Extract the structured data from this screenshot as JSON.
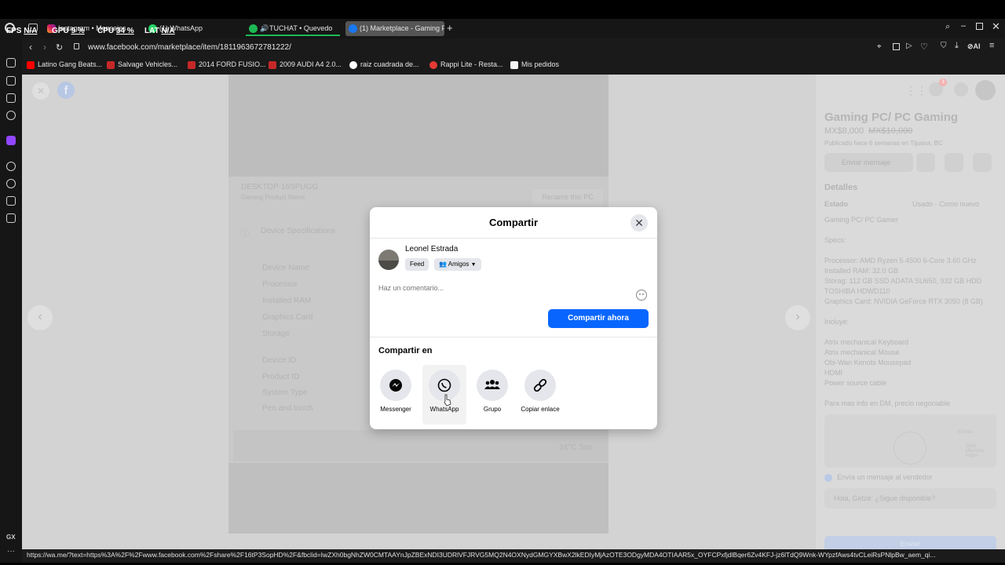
{
  "hud": {
    "fps_label": "FPS",
    "fps_value": "N/A",
    "gpu_label": "GPU",
    "gpu_value": "9 %",
    "cpu_label": "CPU",
    "cpu_value": "34 %",
    "lat_label": "LAT",
    "lat_value": "N/A"
  },
  "tabs": [
    {
      "label": "Instagram • Mensajes"
    },
    {
      "label": "(1) WhatsApp"
    },
    {
      "label": "TUCHAT • Quevedo"
    },
    {
      "label": "(1) Marketplace - Gaming P"
    }
  ],
  "address": {
    "url": "www.facebook.com/marketplace/item/1811963672781222/"
  },
  "bookmarks": [
    {
      "label": "Latino Gang Beats..."
    },
    {
      "label": "Salvage Vehicles..."
    },
    {
      "label": "2014 FORD FUSIO..."
    },
    {
      "label": "2009 AUDI A4 2.0..."
    },
    {
      "label": "raiz cuadrada de..."
    },
    {
      "label": "Rappi Lite - Resta..."
    },
    {
      "label": "Mis pedidos"
    }
  ],
  "background_photo": {
    "device_name_host": "DESKTOP-16SPUGG",
    "device_sub": "Gaming Product Name",
    "rename_button": "Rename this PC",
    "section_title": "Device Specifications",
    "rows": [
      "Device Name",
      "Processor",
      "Installed RAM",
      "Graphics Card",
      "Storage",
      "Device ID",
      "Product ID",
      "System Type",
      "Pen and touch"
    ],
    "taskbar_temp": "24°C Sun"
  },
  "listing": {
    "title": "Gaming PC/ PC Gaming",
    "price": "MX$8,000",
    "old_price": "MX$10,000",
    "published": "Publicado hace 6 semanas en Tijuana, BC",
    "send_message": "Enviar mensaje",
    "details_heading": "Detalles",
    "condition_label": "Estado",
    "condition_value": "Usado - Como nuevo",
    "description": [
      "Gaming PC/ PC Gamer",
      "Specs:",
      "Processor: AMD Ryzen 5 4500 6-Core 3.60 GHz",
      "Installed RAM: 32.0 GB",
      "Storag: 112 GB SSD ADATA SU650, 932 GB HDD",
      "TOSHIBA HDWD110",
      "Graphics Card: NVIDIA GeForce RTX 3050 (8 GB)",
      "Incluye:",
      "Atrix mechanical Keyboard",
      "Atrix mechanical Mouse",
      "Obi-Wan Kenobi Mousepad",
      "HDMI",
      "Power source cable",
      "Para mas info en DM, precio negociable"
    ],
    "map_label_1": "El Nido",
    "map_label_2": "Ejido Maclovio Rojas",
    "seller_message_title": "Envía un mensaje al vendedor",
    "seller_message_placeholder": "Hola, Getze: ¿Sigue disponible?",
    "send_button": "Enviar",
    "notification_count": "3"
  },
  "modal": {
    "title": "Compartir",
    "user_name": "Leonel Estrada",
    "feed_label": "Feed",
    "audience_label": "Amigos",
    "comment_placeholder": "Haz un comentario...",
    "share_now": "Compartir ahora",
    "share_on": "Compartir en",
    "options": [
      {
        "label": "Messenger",
        "icon": "messenger-icon"
      },
      {
        "label": "WhatsApp",
        "icon": "whatsapp-icon"
      },
      {
        "label": "Grupo",
        "icon": "group-icon"
      },
      {
        "label": "Copiar enlace",
        "icon": "link-icon"
      }
    ]
  },
  "status": {
    "url": "https://wa.me/?text=https%3A%2F%2Fwww.facebook.com%2Fshare%2F16tP3SopHD%2F&fbclid=IwZXh0bgNhZW0CMTAAYnJpZBExNDI3UDRlVFJRVG5MQ2N4OXNydGMGYXBwX2lkEDIyMjAzOTE3ODgyMDA4OTIAAR5x_OYFCPxfjdlBqer6Zv4KFJ-jz6lTdQ9Wnk-WYpzfAws4tvCLeiRsPNlpBw_aem_qi..."
  },
  "sidebar": {
    "gx_label": "GX"
  }
}
